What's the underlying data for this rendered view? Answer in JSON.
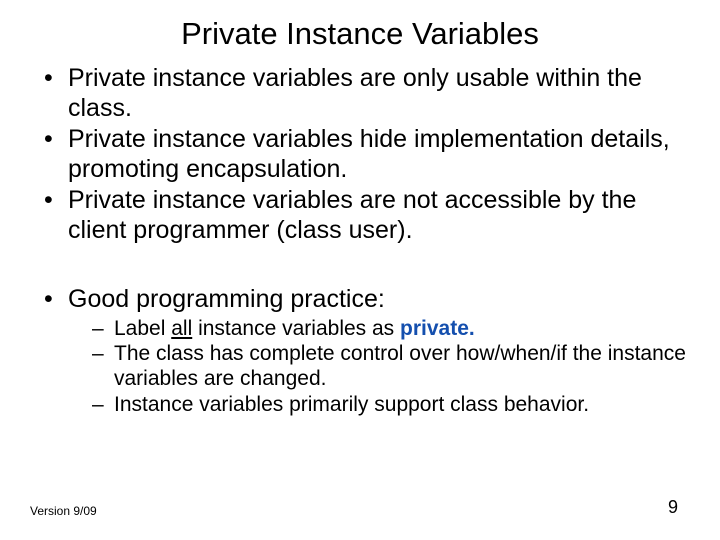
{
  "title": "Private Instance Variables",
  "bullets": {
    "b1": "Private instance variables are only usable within the class.",
    "b2": "Private instance variables hide implementation details, promoting encapsulation.",
    "b3": "Private instance variables are not accessible by the client programmer (class user).",
    "b4": "Good programming practice:",
    "s1a": "Label ",
    "s1b": "all",
    "s1c": " instance variables as ",
    "s1d": "private.",
    "s2": "The class has complete control over how/when/if the instance variables are changed.",
    "s3": "Instance variables primarily support class behavior."
  },
  "footer": {
    "version": "Version 9/09",
    "page": "9"
  }
}
